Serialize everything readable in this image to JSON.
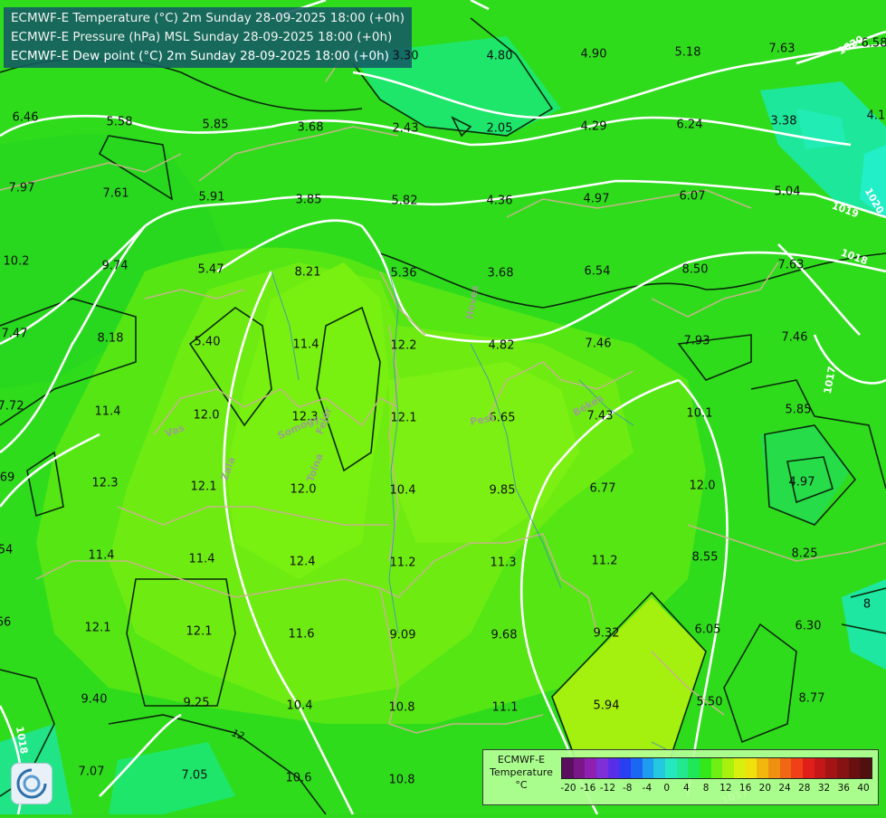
{
  "titles": [
    "ECMWF-E Temperature (°C) 2m Sunday 28-09-2025 18:00 (+0h)",
    "ECMWF-E Pressure (hPa) MSL Sunday 28-09-2025 18:00 (+0h)",
    "ECMWF-E Dew point (°C) 2m Sunday 28-09-2025 18:00 (+0h)"
  ],
  "legend": {
    "title_line1": "ECMWF-E",
    "title_line2": "Temperature",
    "title_line3": "°C",
    "ticks": [
      "-20",
      "-16",
      "-12",
      "-8",
      "-4",
      "0",
      "4",
      "8",
      "12",
      "16",
      "20",
      "24",
      "28",
      "32",
      "36",
      "40"
    ],
    "colors": [
      "#5a0f5e",
      "#7a1788",
      "#8f1fb0",
      "#7e2fd8",
      "#5a2ee8",
      "#2a3ef2",
      "#1c67f2",
      "#1e9cf0",
      "#24c8e0",
      "#25e8c0",
      "#22e890",
      "#1ee858",
      "#32e81a",
      "#6ef014",
      "#a8f00e",
      "#d8f00c",
      "#f0e00c",
      "#f0b80c",
      "#f09010",
      "#f06814",
      "#f04018",
      "#e02018",
      "#c41818",
      "#a41414",
      "#861212",
      "#6a1010",
      "#501010"
    ]
  },
  "values": [
    {
      "t": "3.30"
    },
    {
      "t": "4.80"
    },
    {
      "t": "4.90"
    },
    {
      "t": "5.18"
    },
    {
      "t": "7.63"
    },
    {
      "t": "6.58"
    },
    {
      "t": "5.58"
    },
    {
      "t": "5.85"
    },
    {
      "t": "3.68"
    },
    {
      "t": "2.43"
    },
    {
      "t": "2.05"
    },
    {
      "t": "4.29"
    },
    {
      "t": "6.24"
    },
    {
      "t": "3.38"
    },
    {
      "t": "4.1"
    },
    {
      "t": "6.46"
    },
    {
      "t": "7.97"
    },
    {
      "t": "7.61"
    },
    {
      "t": "5.91"
    },
    {
      "t": "3.85"
    },
    {
      "t": "5.82"
    },
    {
      "t": "4.36"
    },
    {
      "t": "4.97"
    },
    {
      "t": "6.07"
    },
    {
      "t": "5.04"
    },
    {
      "t": "10.2"
    },
    {
      "t": "9.74"
    },
    {
      "t": "5.47"
    },
    {
      "t": "8.21"
    },
    {
      "t": "5.36"
    },
    {
      "t": "3.68"
    },
    {
      "t": "6.54"
    },
    {
      "t": "8.50"
    },
    {
      "t": "7.63"
    },
    {
      "t": "7.47"
    },
    {
      "t": "8.18"
    },
    {
      "t": "5.40"
    },
    {
      "t": "11.4"
    },
    {
      "t": "12.2"
    },
    {
      "t": "4.82"
    },
    {
      "t": "7.46"
    },
    {
      "t": "7.93"
    },
    {
      "t": "7.46"
    },
    {
      "t": "7.72"
    },
    {
      "t": "11.4"
    },
    {
      "t": "12.0"
    },
    {
      "t": "12.3"
    },
    {
      "t": "12.1"
    },
    {
      "t": "6.65"
    },
    {
      "t": "7.43"
    },
    {
      "t": "10.1"
    },
    {
      "t": "5.85"
    },
    {
      "t": "69"
    },
    {
      "t": "12.3"
    },
    {
      "t": "12.1"
    },
    {
      "t": "12.0"
    },
    {
      "t": "10.4"
    },
    {
      "t": "9.85"
    },
    {
      "t": "6.77"
    },
    {
      "t": "12.0"
    },
    {
      "t": "4.97"
    },
    {
      "t": "54"
    },
    {
      "t": "11.4"
    },
    {
      "t": "11.4"
    },
    {
      "t": "12.4"
    },
    {
      "t": "11.2"
    },
    {
      "t": "11.3"
    },
    {
      "t": "11.2"
    },
    {
      "t": "8.55"
    },
    {
      "t": "8.25"
    },
    {
      "t": "66"
    },
    {
      "t": "12.1"
    },
    {
      "t": "12.1"
    },
    {
      "t": "11.6"
    },
    {
      "t": "9.09"
    },
    {
      "t": "9.68"
    },
    {
      "t": "9.32"
    },
    {
      "t": "6.05"
    },
    {
      "t": "6.30"
    },
    {
      "t": "8"
    },
    {
      "t": "9.40"
    },
    {
      "t": "9.25"
    },
    {
      "t": "10.4"
    },
    {
      "t": "10.8"
    },
    {
      "t": "11.1"
    },
    {
      "t": "5.94"
    },
    {
      "t": "5.50"
    },
    {
      "t": "8.77"
    },
    {
      "t": "7.07"
    },
    {
      "t": "7.05"
    },
    {
      "t": "10.6"
    },
    {
      "t": "10.8"
    }
  ],
  "isobar_labels": [
    "1020",
    "1019",
    "1018",
    "1017",
    "1018",
    "1017",
    "1020"
  ],
  "contour_label": "12",
  "place_labels": [
    "Vas",
    "Zala",
    "Somogy",
    "Fejér",
    "Tolna",
    "Heves",
    "Pest",
    "Békés"
  ]
}
